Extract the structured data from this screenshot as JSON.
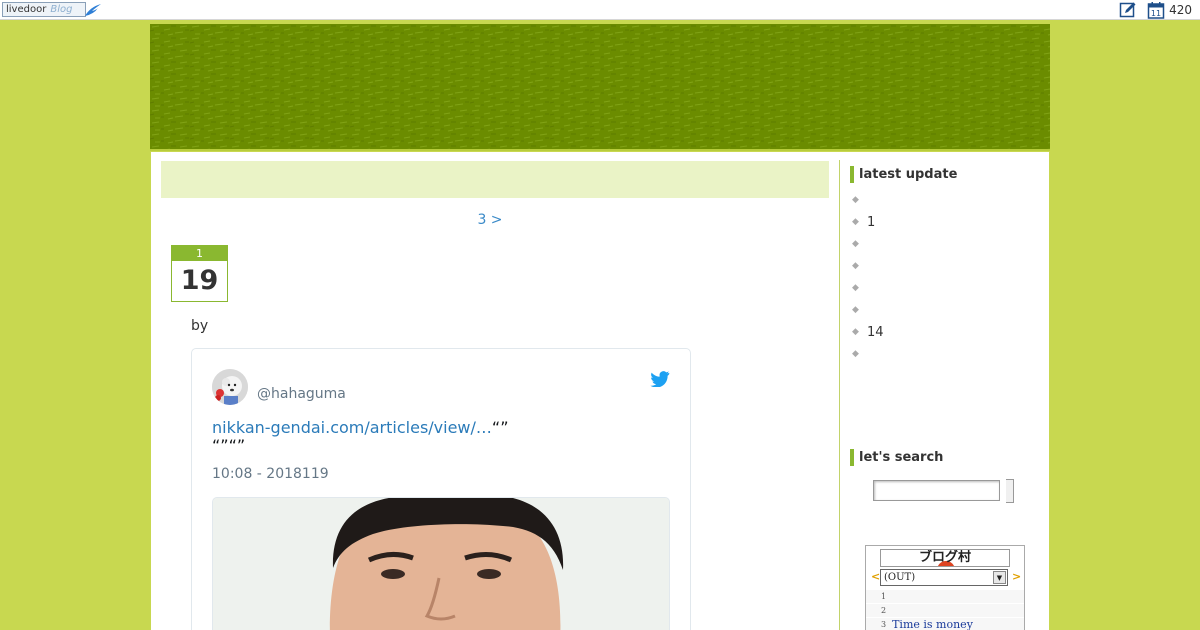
{
  "toolbar": {
    "logo_text": "livedoor",
    "logo_sub": "Blog",
    "count": "420",
    "edit_icon": "edit-pencil-icon",
    "calendar_icon": "calendar-icon",
    "calendar_day": "11"
  },
  "main": {
    "pager_label": "3 >",
    "entry": {
      "month": "1",
      "day": "19",
      "byline": "by"
    },
    "tweet": {
      "handle": "@hahaguma",
      "link_text": "nikkan-gendai.com/articles/view/…",
      "text_after_link": "“”",
      "text_line2": "“”“”",
      "time": "10:08 - 2018119",
      "bird_icon": "twitter-bird-icon"
    }
  },
  "sidebar": {
    "latest_title": "latest update",
    "latest_items": [
      "",
      "1",
      "",
      "",
      "",
      "",
      "14",
      ""
    ],
    "search_title": "let's search",
    "search_value": "",
    "ranking": {
      "logo": "ブログ村",
      "prev": "<",
      "next": ">",
      "select_value": "(OUT)",
      "rows": [
        {
          "rank": "1",
          "title": ""
        },
        {
          "rank": "2",
          "title": ""
        },
        {
          "rank": "3",
          "title": "Time is money"
        }
      ]
    }
  },
  "colors": {
    "page_bg": "#c8d850",
    "banner": "#6b8c00",
    "accent": "#8ab830",
    "link": "#2b7bb9"
  }
}
